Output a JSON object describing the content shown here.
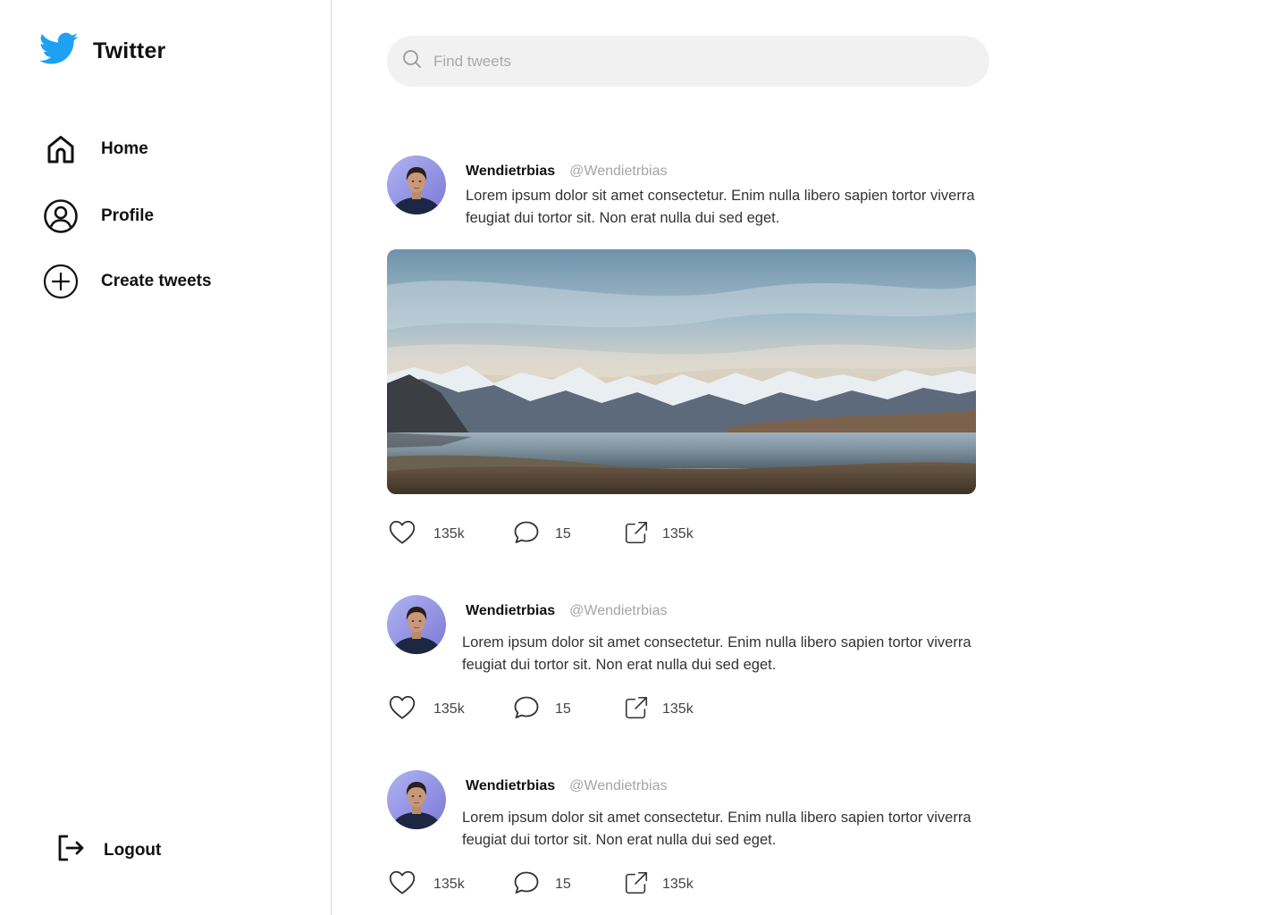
{
  "app": {
    "name": "Twitter",
    "accent": "#1DA1F2"
  },
  "sidebar": {
    "items": [
      {
        "label": "Home",
        "icon": "home-icon"
      },
      {
        "label": "Profile",
        "icon": "user-circle-icon"
      },
      {
        "label": "Create tweets",
        "icon": "plus-circle-icon"
      }
    ],
    "logout_label": "Logout"
  },
  "search": {
    "placeholder": "Find tweets",
    "value": ""
  },
  "tweets": [
    {
      "name": "Wendietrbias",
      "handle": "@Wendietrbias",
      "text": "Lorem ipsum dolor sit amet consectetur. Enim nulla libero sapien tortor viverra feugiat dui tortor sit. Non erat nulla dui sed eget.",
      "has_image": true,
      "image": "mountain-lake-landscape",
      "likes": "135k",
      "comments": "15",
      "shares": "135k"
    },
    {
      "name": "Wendietrbias",
      "handle": "@Wendietrbias",
      "text": "Lorem ipsum dolor sit amet consectetur. Enim nulla libero sapien tortor viverra feugiat dui tortor sit. Non erat nulla dui sed eget.",
      "has_image": false,
      "likes": "135k",
      "comments": "15",
      "shares": "135k"
    },
    {
      "name": "Wendietrbias",
      "handle": "@Wendietrbias",
      "text": "Lorem ipsum dolor sit amet consectetur. Enim nulla libero sapien tortor viverra feugiat dui tortor sit. Non erat nulla dui sed eget.",
      "has_image": false,
      "likes": "135k",
      "comments": "15",
      "shares": "135k"
    }
  ]
}
